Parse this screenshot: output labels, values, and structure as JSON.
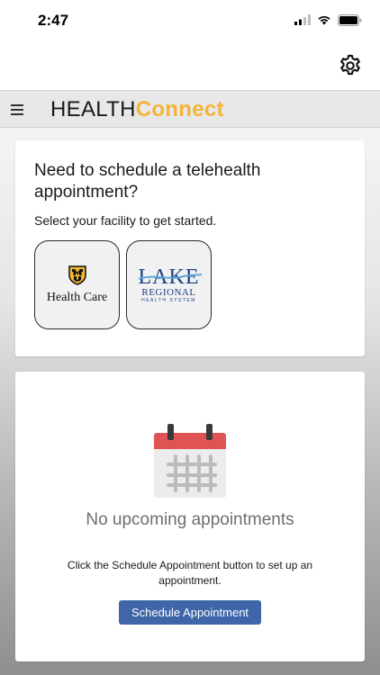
{
  "status_bar": {
    "time": "2:47"
  },
  "header": {
    "brand_part1": "HEALTH",
    "brand_part2": "Connect",
    "brand_accent_color": "#f4b43a"
  },
  "icons": {
    "settings": "gear-icon",
    "menu": "hamburger-menu-icon",
    "calendar": "calendar-icon"
  },
  "schedule_card": {
    "title": "Need to schedule a telehealth appointment?",
    "subtitle": "Select your facility to get started.",
    "facilities": [
      {
        "logo_text": "Health Care"
      },
      {
        "logo_text_1": "LAKE",
        "logo_text_2": "REGIONAL",
        "logo_text_3": "HEALTH SYSTEM"
      }
    ]
  },
  "appointments_card": {
    "empty_message": "No upcoming appointments",
    "help_text": "Click the Schedule Appointment button to set up an appointment.",
    "button_label": "Schedule Appointment",
    "button_color": "#3e66a8"
  }
}
